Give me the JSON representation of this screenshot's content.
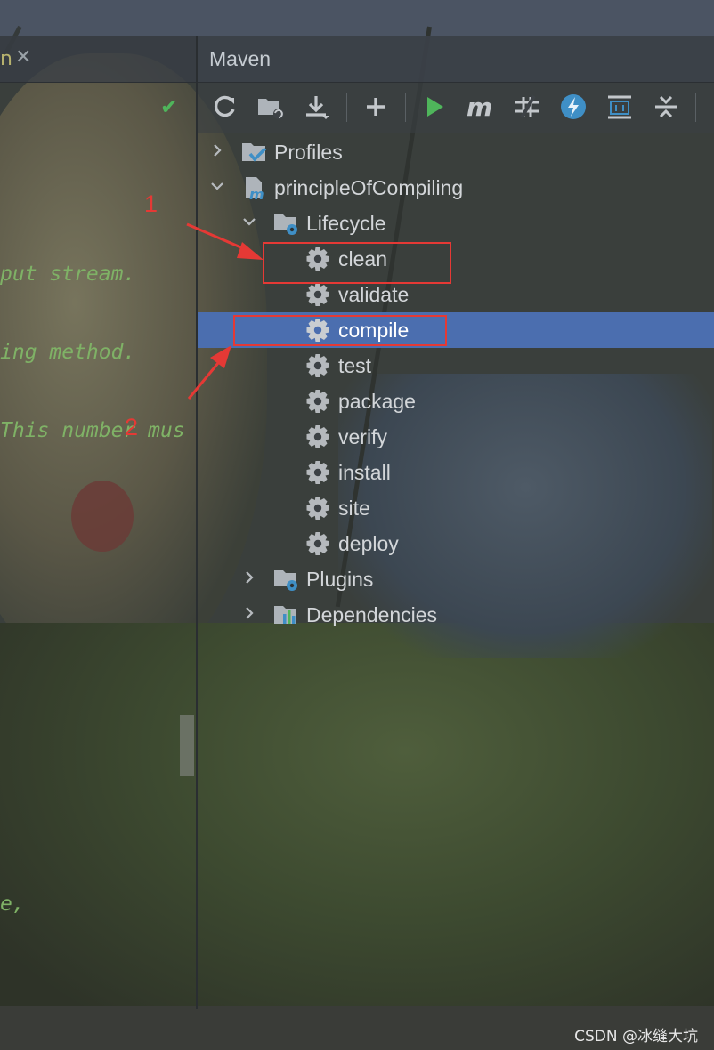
{
  "editor": {
    "tab_fragment": "n",
    "code_lines": [
      "put stream.",
      "ing method.",
      "This number mus",
      "e,"
    ]
  },
  "maven": {
    "title": "Maven",
    "toolbar": [
      "reload-icon",
      "generate-sources-icon",
      "download-icon",
      "add-icon",
      "run-icon",
      "execute-goal-icon",
      "toggle-offline-icon",
      "skip-tests-icon",
      "show-dependencies-icon",
      "collapse-all-icon"
    ],
    "tree": {
      "profiles": "Profiles",
      "project": "principleOfCompiling",
      "lifecycle": "Lifecycle",
      "goals": [
        "clean",
        "validate",
        "compile",
        "test",
        "package",
        "verify",
        "install",
        "site",
        "deploy"
      ],
      "selected_goal": "compile",
      "plugins": "Plugins",
      "dependencies": "Dependencies"
    }
  },
  "annotations": {
    "one": "1",
    "two": "2"
  },
  "colors": {
    "selection": "#4b6eaf",
    "annotation": "#e53935",
    "run_green": "#4fb55b"
  },
  "watermark": "CSDN @冰缝大坑"
}
